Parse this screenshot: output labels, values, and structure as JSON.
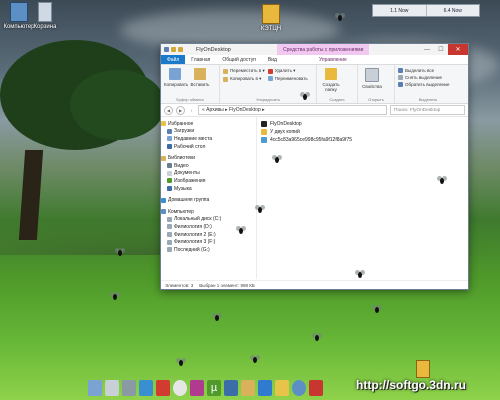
{
  "desktop": {
    "icons": [
      {
        "label": "Компьютер",
        "icon": "computer-icon"
      },
      {
        "label": "Корзина",
        "icon": "recycle-bin-icon"
      },
      {
        "label": "КЭТЦН",
        "icon": "folder-icon"
      }
    ],
    "widget": {
      "left": "1.1 Now",
      "right": "6.4 Now"
    },
    "watermark": "http://softgo.3dn.ru"
  },
  "window": {
    "title": "FlyOnDesktop",
    "context_tab": "Средства работы с приложениями",
    "controls": {
      "minimize": "—",
      "maximize": "☐",
      "close": "✕"
    },
    "ribbon_tabs": [
      "Файл",
      "Главная",
      "Общий доступ",
      "Вид",
      "Управление"
    ],
    "ribbon": {
      "clipboard": {
        "copy": "Копировать",
        "paste": "Вставить",
        "label": "Буфер обмена"
      },
      "organize": {
        "move": "Переместить в ▾",
        "copy_to": "Копировать в ▾",
        "label": "Упорядочить"
      },
      "organize2": {
        "delete": "Удалить ▾",
        "rename": "Переименовать"
      },
      "create": {
        "new_folder": "Создать папку",
        "label": "Создать"
      },
      "open": {
        "properties": "Свойства",
        "label": "Открыть"
      },
      "select": {
        "all": "Выделить все",
        "none": "Снять выделение",
        "invert": "Обратить выделение",
        "label": "Выделить"
      }
    },
    "address": {
      "path": "« Архивы ▸ FlyOnDesktop ▸",
      "search_placeholder": "Поиск: FlyOnDesktop"
    },
    "nav": {
      "favorites": "Избранное",
      "downloads": "Загрузки",
      "recent": "Недавние места",
      "desktop": "Рабочий стол",
      "libraries": "Библиотеки",
      "video": "Видео",
      "documents": "Документы",
      "pictures": "Изображения",
      "music": "Музыка",
      "homegroup": "Домашняя группа",
      "computer": "Компьютер",
      "drives": [
        "Локальный диск (C:)",
        "Филиология (D:)",
        "Филиология 2 (E:)",
        "Филиология 3 (F:)",
        "Последний (G:)"
      ]
    },
    "files": [
      {
        "name": "FlyOnDesktop",
        "icon": "app-icon"
      },
      {
        "name": "У двух копий",
        "icon": "folder-icon"
      },
      {
        "name": "4cc5c83a965ce998c95fa9f12f8a9f75",
        "icon": "image-file-icon"
      }
    ],
    "status": {
      "count": "Элементов: 3",
      "selected": "Выбран 1 элемент: 998 КБ"
    }
  }
}
